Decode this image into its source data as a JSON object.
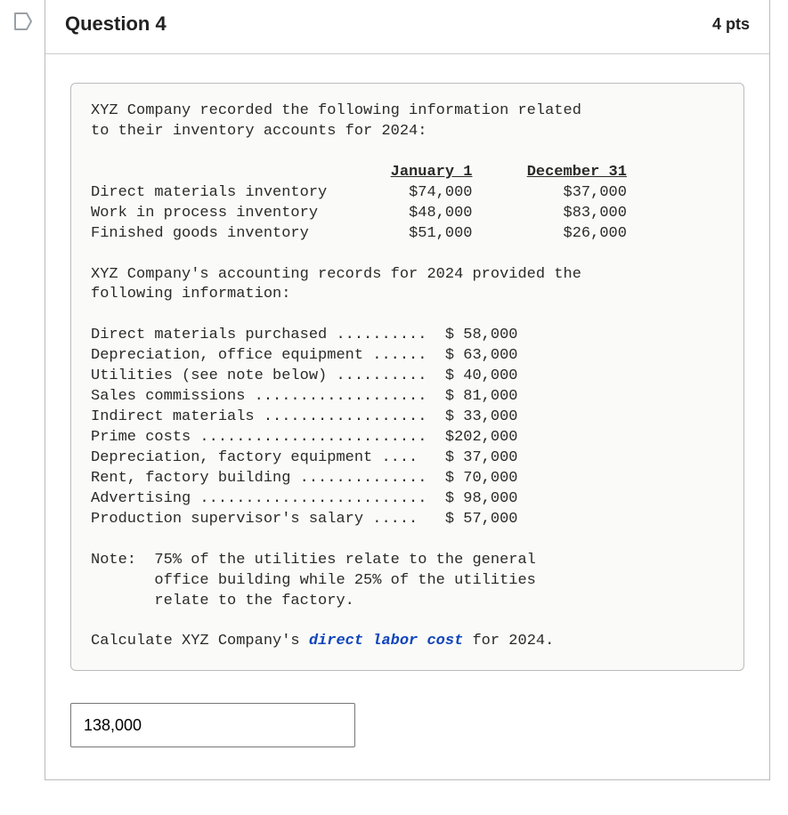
{
  "header": {
    "title": "Question 4",
    "points": "4 pts"
  },
  "content": {
    "intro1": "XYZ Company recorded the following information related",
    "intro2": "to their inventory accounts for 2024:",
    "col1": "January 1",
    "col2": "December 31",
    "inventory": [
      {
        "label": "Direct materials inventory",
        "jan": "$74,000",
        "dec": "$37,000"
      },
      {
        "label": "Work in process inventory",
        "jan": "$48,000",
        "dec": "$83,000"
      },
      {
        "label": "Finished goods inventory",
        "jan": "$51,000",
        "dec": "$26,000"
      }
    ],
    "mid1": "XYZ Company's accounting records for 2024 provided the",
    "mid2": "following information:",
    "records": [
      {
        "label": "Direct materials purchased ..........",
        "val": "$ 58,000"
      },
      {
        "label": "Depreciation, office equipment ......",
        "val": "$ 63,000"
      },
      {
        "label": "Utilities (see note below) ..........",
        "val": "$ 40,000"
      },
      {
        "label": "Sales commissions ...................",
        "val": "$ 81,000"
      },
      {
        "label": "Indirect materials ..................",
        "val": "$ 33,000"
      },
      {
        "label": "Prime costs .........................",
        "val": "$202,000"
      },
      {
        "label": "Depreciation, factory equipment ....",
        "val": "$ 37,000"
      },
      {
        "label": "Rent, factory building ..............",
        "val": "$ 70,000"
      },
      {
        "label": "Advertising .........................",
        "val": "$ 98,000"
      },
      {
        "label": "Production supervisor's salary .....",
        "val": "$ 57,000"
      }
    ],
    "note1": "Note:  75% of the utilities relate to the general",
    "note2": "       office building while 25% of the utilities",
    "note3": "       relate to the factory.",
    "calc_prefix": "Calculate XYZ Company's ",
    "calc_emph": "direct labor cost",
    "calc_suffix": " for 2024."
  },
  "answer": {
    "value": "138,000"
  }
}
